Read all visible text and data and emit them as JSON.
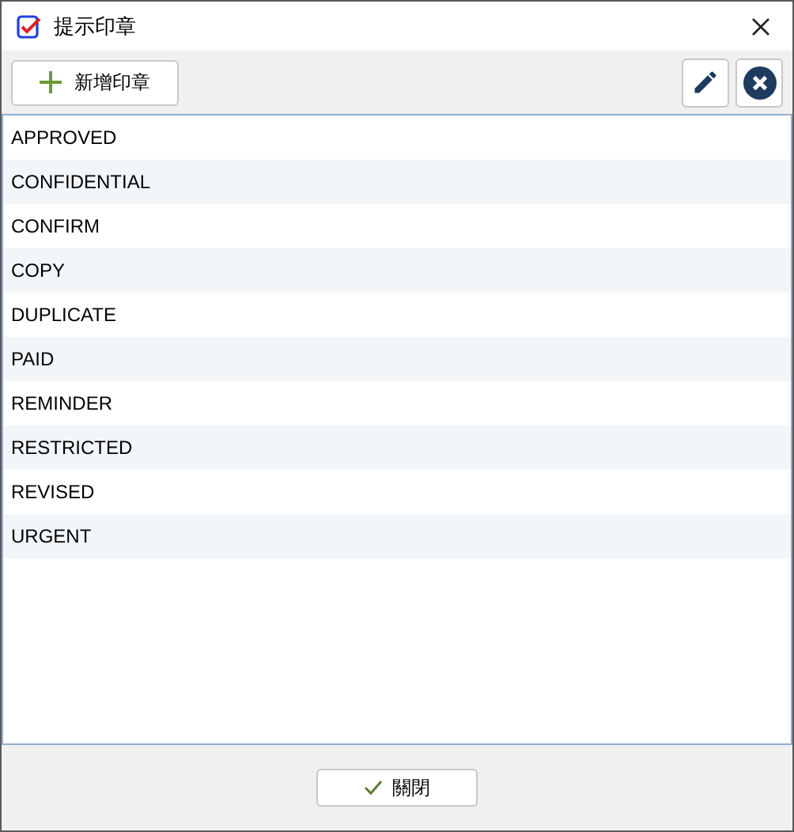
{
  "window": {
    "title": "提示印章"
  },
  "toolbar": {
    "add_button": "新增印章"
  },
  "stamps": [
    "APPROVED",
    "CONFIDENTIAL",
    "CONFIRM",
    "COPY",
    "DUPLICATE",
    "PAID",
    "REMINDER",
    "RESTRICTED",
    "REVISED",
    "URGENT"
  ],
  "footer": {
    "close_button": "關閉"
  }
}
